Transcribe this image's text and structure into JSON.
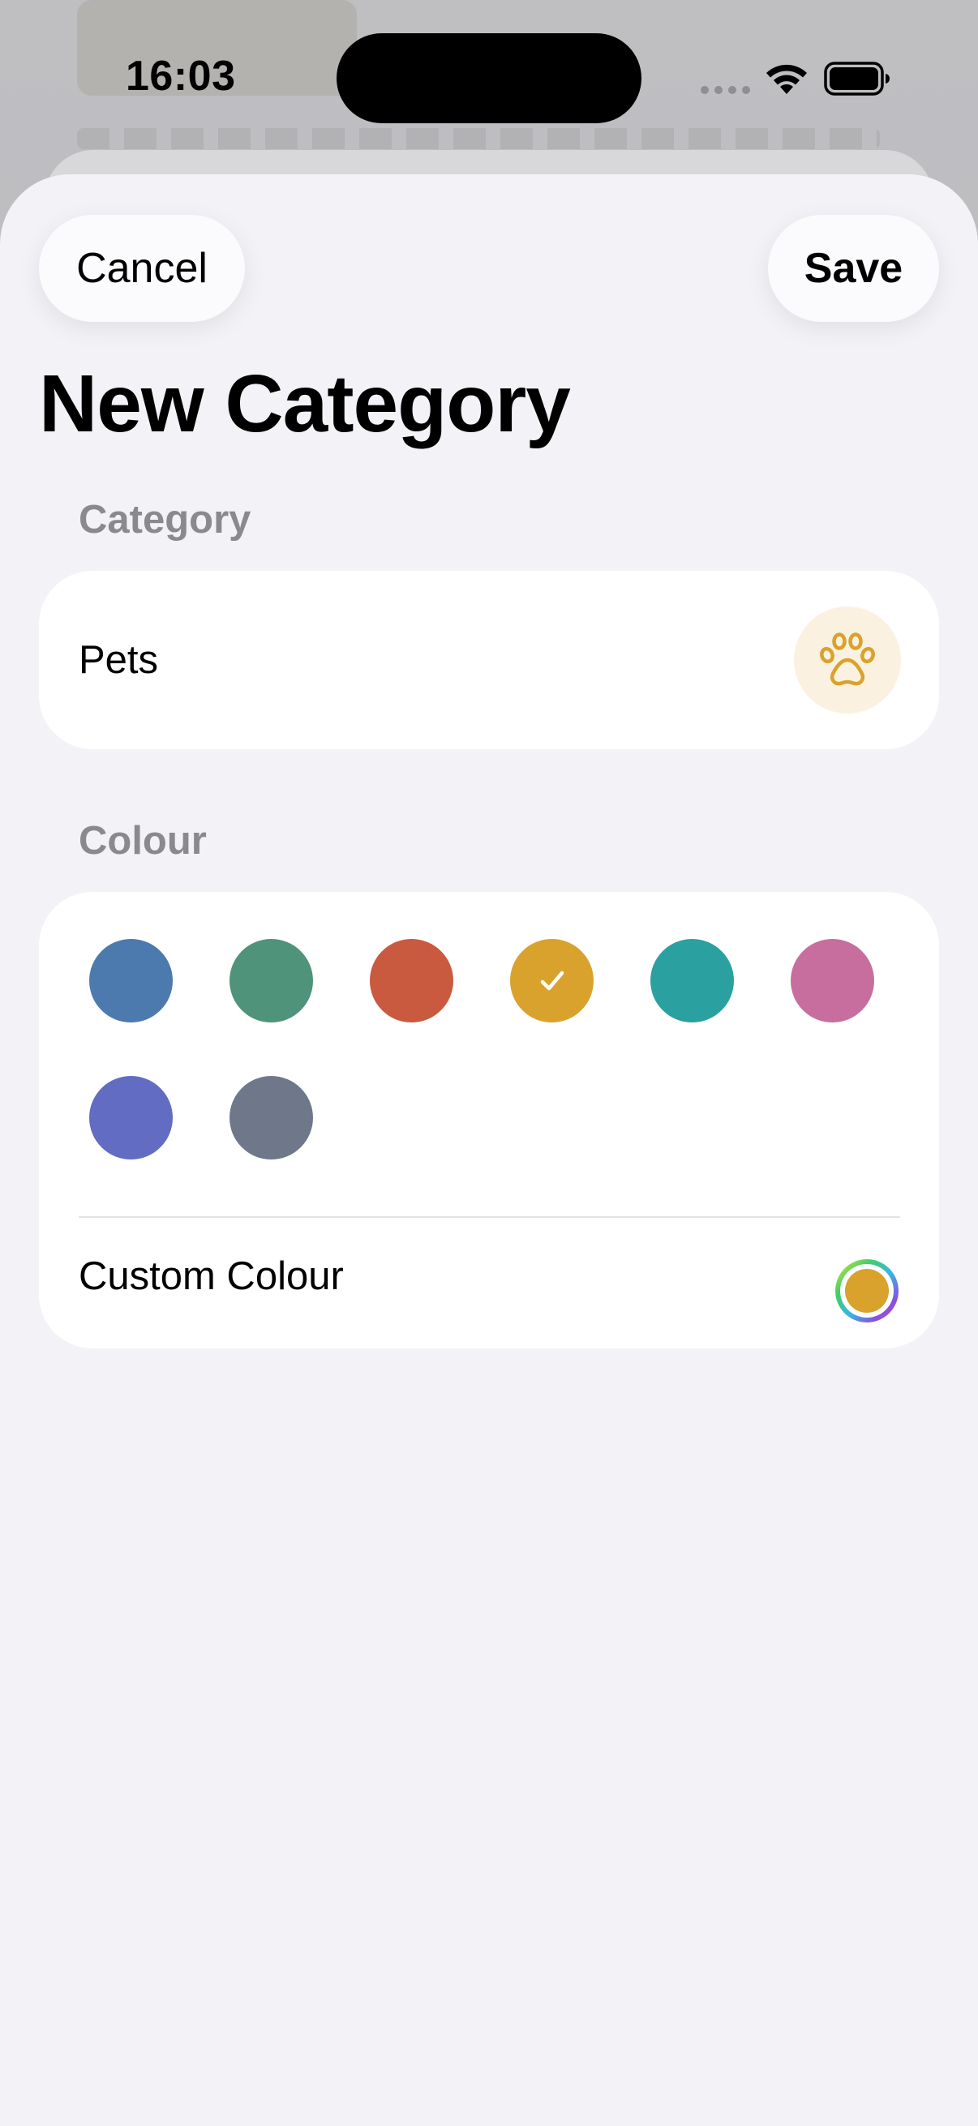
{
  "status_bar": {
    "time": "16:03"
  },
  "header": {
    "cancel_label": "Cancel",
    "save_label": "Save",
    "title": "New Category"
  },
  "category_section": {
    "label": "Category",
    "name": "Pets",
    "icon": "paw-icon",
    "icon_color": "#D9A22C",
    "icon_bg": "#FAF1E0"
  },
  "colour_section": {
    "label": "Colour",
    "swatches": [
      {
        "name": "blue",
        "color": "#4D7AAE",
        "selected": false
      },
      {
        "name": "green",
        "color": "#4E937A",
        "selected": false
      },
      {
        "name": "red",
        "color": "#C95A3F",
        "selected": false
      },
      {
        "name": "yellow",
        "color": "#D9A22C",
        "selected": true
      },
      {
        "name": "teal",
        "color": "#2BA0A0",
        "selected": false
      },
      {
        "name": "pink",
        "color": "#C76E9E",
        "selected": false
      },
      {
        "name": "indigo",
        "color": "#626CC3",
        "selected": false
      },
      {
        "name": "slate",
        "color": "#6E788A",
        "selected": false
      }
    ],
    "selected_icon": "checkmark-icon",
    "custom_label": "Custom Colour",
    "custom_icon": "color-wheel-icon",
    "custom_color": "#D9A22C"
  }
}
